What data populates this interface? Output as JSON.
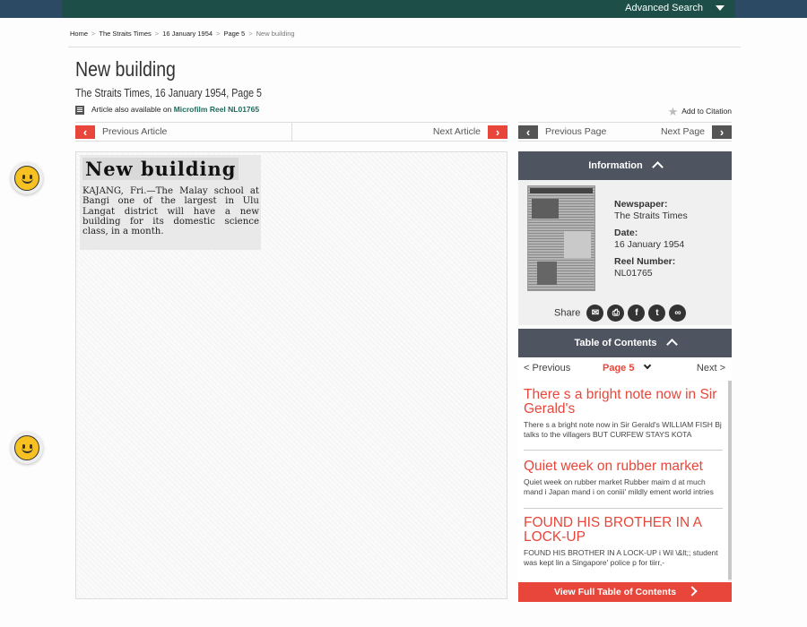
{
  "topbar": {
    "advanced_search": "Advanced Search"
  },
  "breadcrumb": [
    "Home",
    "The Straits Times",
    "16 January 1954",
    "Page 5",
    "New building"
  ],
  "article": {
    "title": "New building",
    "subtitle": "The Straits Times, 16 January 1954, Page 5",
    "available_prefix": "Article also available on",
    "available_link": "Microfilm Reel NL01765",
    "add_citation": "Add to Citation"
  },
  "nav": {
    "previous_article": "Previous Article",
    "next_article": "Next Article",
    "previous_page": "Previous Page",
    "next_page": "Next Page"
  },
  "clipping": {
    "headline": "New building",
    "body": "KAJANG, Fri.—The Malay school at Bangi one of the largest in Ulu Langat district will have a new building for its domestic science class, in a month."
  },
  "info": {
    "header": "Information",
    "newspaper_label": "Newspaper:",
    "newspaper_value": "The Straits Times",
    "date_label": "Date:",
    "date_value": "16 January 1954",
    "reel_label": "Reel Number:",
    "reel_value": "NL01765",
    "share_label": "Share"
  },
  "toc": {
    "header": "Table of Contents",
    "previous": "< Previous",
    "page": "Page 5",
    "next": "Next >",
    "items": [
      {
        "title": "There s a bright note now in Sir Gerald's",
        "desc": "There s a bright note now in Sir Gerald's WILLIAM FISH Bj talks to the villagers BUT CURFEW STAYS KOTA"
      },
      {
        "title": "Quiet week on rubber market",
        "desc": "Quiet week on rubber market Rubber maim d at much mand i Japan mand i on coniii' mildly ement world intries"
      },
      {
        "title": "FOUND HIS BROTHER IN A LOCK-UP",
        "desc": "FOUND HIS BROTHER IN A LOCK-UP i Wil \\&lt;; student was kept lin a Singapore' police p for tiirr,-"
      }
    ],
    "full_button": "View Full Table of Contents"
  },
  "colors": {
    "accent": "#e8463a",
    "panel": "#4e5560",
    "topbar": "#1d4e47"
  }
}
